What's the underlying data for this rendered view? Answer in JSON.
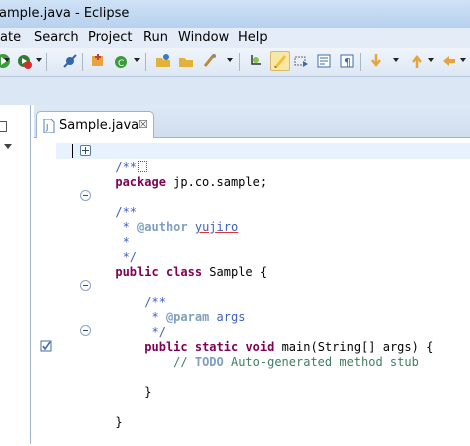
{
  "window": {
    "title": "ample.java - Eclipse"
  },
  "menu": [
    "ate",
    "Search",
    "Project",
    "Run",
    "Window",
    "Help"
  ],
  "toolbar": {
    "icons": [
      "run-icon",
      "debug-icon",
      "external-tools-icon",
      "breakpoint-skip-icon",
      "new-java-project-icon",
      "new-class-icon",
      "open-type-icon",
      "open-folder-icon",
      "search-icon",
      "next-annotation-icon",
      "mark-occurrences-icon",
      "block-selection-icon",
      "word-wrap-icon",
      "show-whitespace-icon",
      "next-annotation-down-icon",
      "back-icon",
      "forward-icon"
    ]
  },
  "editor": {
    "tab_label": "Sample.java",
    "tab_close": "☒",
    "lines": {
      "l1": "/**",
      "l2_kw": "package",
      "l2_rest": " jp.co.sample;",
      "l4": "/**",
      "l5_pre": " * ",
      "l5_tag": "@author",
      "l5_sp": " ",
      "l5_val": "yujiro",
      "l6": " *",
      "l7": " */",
      "l8_kw1": "public",
      "l8_sp": " ",
      "l8_kw2": "class",
      "l8_rest": " Sample {",
      "l10": "    /**",
      "l11_pre": "     * ",
      "l11_tag": "@param",
      "l11_val": " args",
      "l12": "     */",
      "l13_ind": "    ",
      "l13_kw1": "public",
      "l13_kw2": "static",
      "l13_kw3": "void",
      "l13_rest": " main(String[] args) {",
      "l14_ind": "        ",
      "l14_slash": "// ",
      "l14_todo": "TODO",
      "l14_rest": " Auto-generated method stub",
      "l16": "    }",
      "l18": "}"
    }
  }
}
